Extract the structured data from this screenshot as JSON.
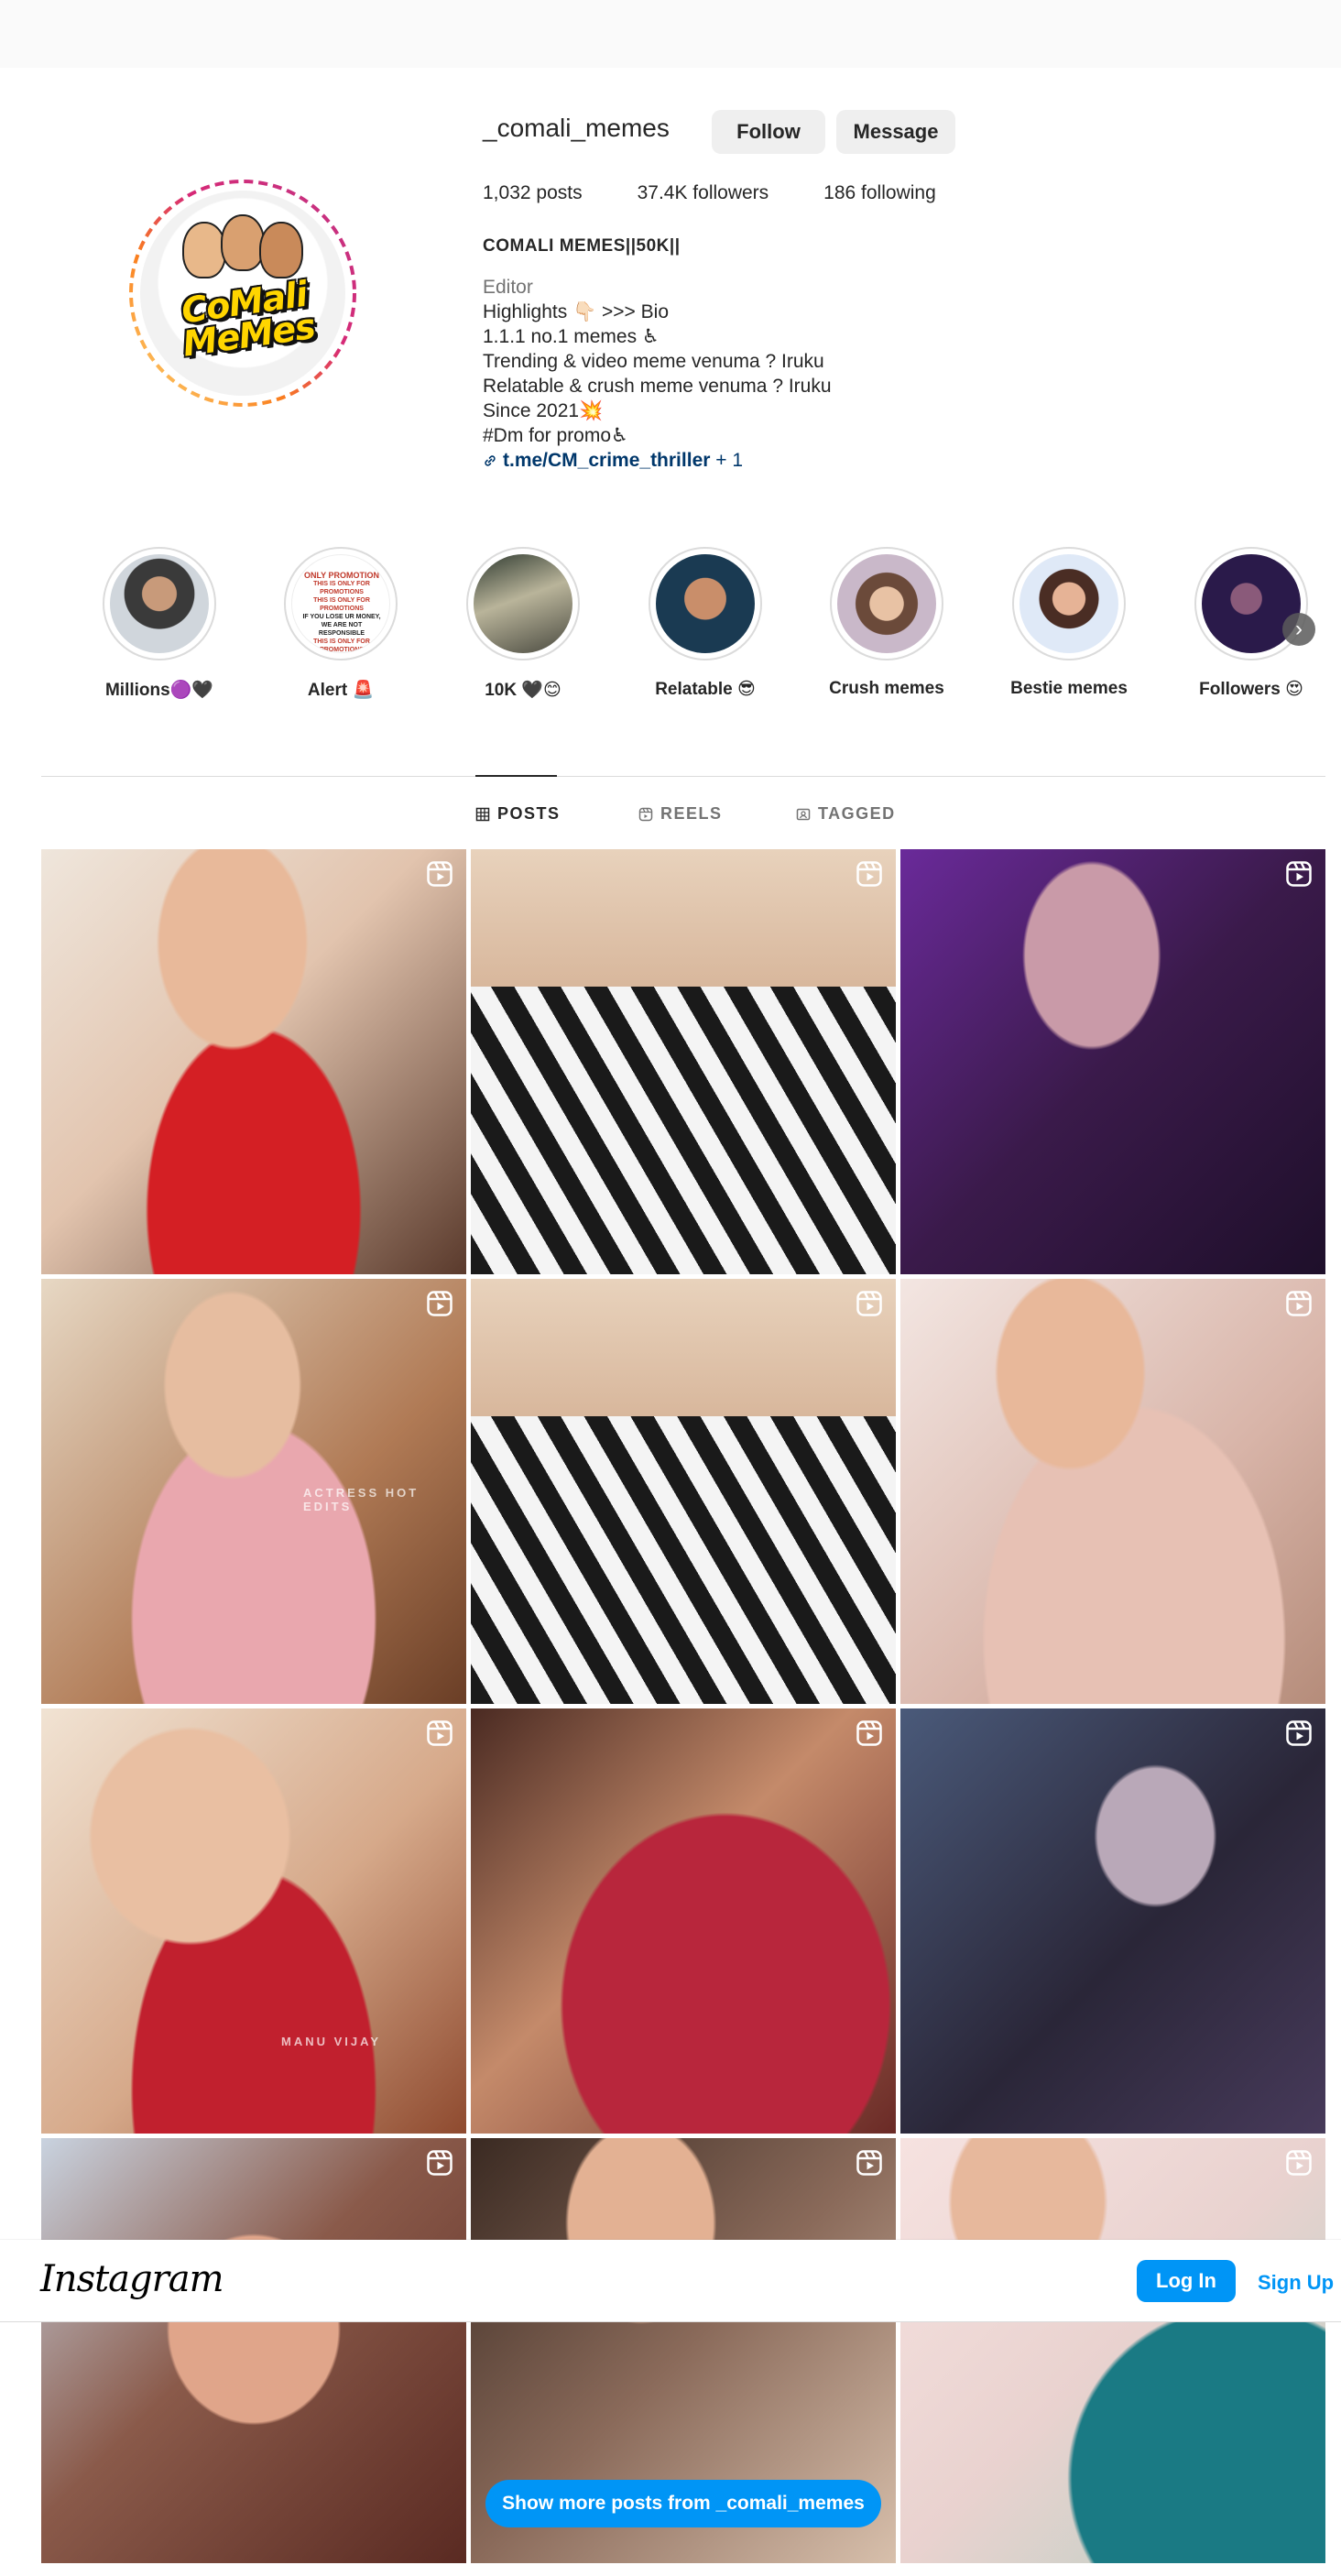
{
  "profile": {
    "username": "_comali_memes",
    "follow_label": "Follow",
    "message_label": "Message",
    "stats": {
      "posts": "1,032 posts",
      "followers": "37.4K followers",
      "following": "186 following"
    },
    "full_name": "COMALI MEMES||50K||",
    "category": "Editor",
    "bio_lines": [
      "Highlights 👇🏻 >>> Bio",
      "1.1.1 no.1 memes ♿",
      "Trending & video meme venuma ? Iruku",
      "Relatable & crush meme venuma ? Iruku",
      "Since 2021💥",
      "#Dm for promo♿"
    ],
    "link_text": "t.me/CM_crime_thriller",
    "link_more": " + 1",
    "avatar_logo_lines": [
      "CoMali",
      "MeMes"
    ]
  },
  "highlights": [
    {
      "label": "Millions🟣🖤"
    },
    {
      "label": "Alert 🚨"
    },
    {
      "label": "10K 🖤😊"
    },
    {
      "label": "Relatable 😎"
    },
    {
      "label": "Crush memes"
    },
    {
      "label": "Bestie memes"
    },
    {
      "label": "Followers 😍"
    }
  ],
  "highlight_promo_text": [
    "ONLY PROMOTION",
    "THIS IS ONLY FOR PROMOTIONS",
    "IF YOU LOSE UR MONEY,",
    "WE ARE NOT RESPONSIBLE"
  ],
  "tabs": [
    {
      "label": "POSTS",
      "icon": "grid-icon",
      "active": true
    },
    {
      "label": "REELS",
      "icon": "reels-icon",
      "active": false
    },
    {
      "label": "TAGGED",
      "icon": "tagged-icon",
      "active": false
    }
  ],
  "posts": [
    {
      "type": "reel",
      "icon": "reel-icon"
    },
    {
      "type": "reel",
      "icon": "reel-icon"
    },
    {
      "type": "reel",
      "icon": "reel-icon"
    },
    {
      "type": "reel",
      "icon": "reel-icon",
      "watermark": "ACTRESS HOT EDITS"
    },
    {
      "type": "reel",
      "icon": "reel-icon"
    },
    {
      "type": "reel",
      "icon": "reel-icon"
    },
    {
      "type": "reel",
      "icon": "reel-icon",
      "watermark": "MANU VIJAY"
    },
    {
      "type": "reel",
      "icon": "reel-icon"
    },
    {
      "type": "reel",
      "icon": "reel-icon"
    },
    {
      "type": "reel",
      "icon": "reel-icon"
    },
    {
      "type": "reel",
      "icon": "reel-icon"
    },
    {
      "type": "reel",
      "icon": "reel-icon"
    }
  ],
  "banner": {
    "logo": "Instagram",
    "login_label": "Log In",
    "signup_label": "Sign Up"
  },
  "show_more_label": "Show more posts from _comali_memes",
  "colors": {
    "accent": "#0095f6",
    "link": "#00376b",
    "muted": "#737373"
  }
}
